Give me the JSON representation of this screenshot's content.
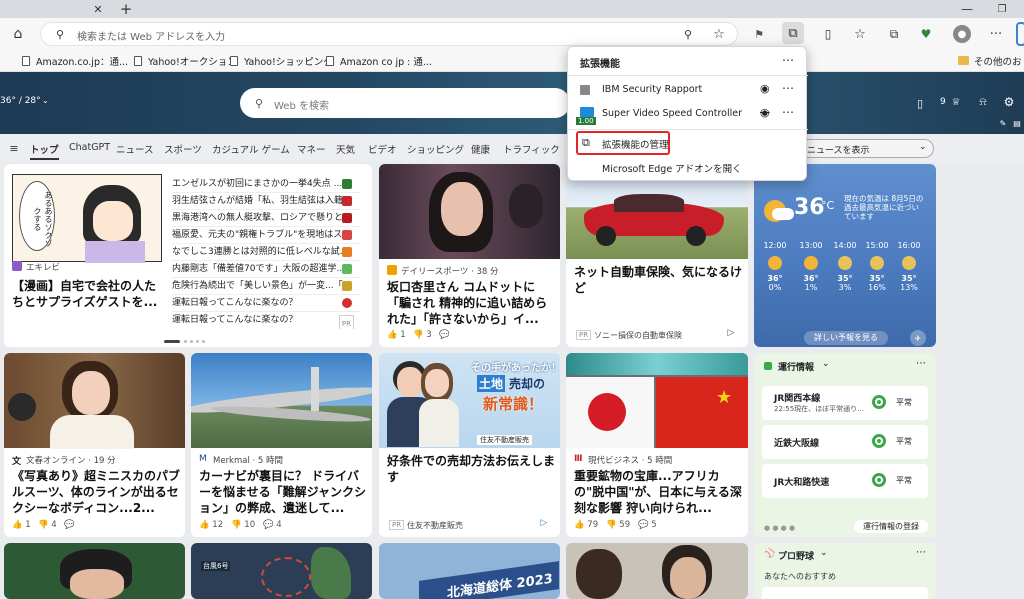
{
  "browser": {
    "address_placeholder": "検索または Web アドレスを入力",
    "bookmarks": [
      "Amazon.co.jp：通...",
      "Yahoo!オークション",
      "Yahoo!ショッピング",
      "Amazon co jp : 通...",
      "その他のお"
    ]
  },
  "hero": {
    "temp": "36° / 28°",
    "search_placeholder": "Web を検索",
    "points": "9"
  },
  "nav": {
    "items": [
      "トップ",
      "ChatGPT",
      "ニュース",
      "スポーツ",
      "カジュアル ゲーム",
      "マネー",
      "天気",
      "ビデオ",
      "ショッピング",
      "健康",
      "トラフィック"
    ],
    "show_news_label": "ニュースを表示"
  },
  "extensions_menu": {
    "title": "拡張機能",
    "items": [
      "IBM Security Rapport",
      "Super Video Speed Controller"
    ],
    "speed_badge": "1.00",
    "manage_label": "拡張機能の管理",
    "addons_label": "Microsoft Edge アドオンを開く"
  },
  "card1": {
    "source": "エキレビ",
    "title": "【漫画】自宅で会社の人たちとサプライズゲストを...",
    "comic_text": "あるあるゾクゾクする",
    "headlines": [
      "エンゼルスが初回にまさかの一挙4失点 ...",
      "羽生結弦さんが結婚「私、羽生結弦は入籍...",
      "黒海港湾への無人艇攻撃、ロシアで懸りと...",
      "福原愛、元夫の\"親権トラブル\"を現地はス...",
      "なでしこ3連勝とは対照的に低レベルな試...",
      "内藤剛志「備差値70です」大阪の超進学...",
      "危険行為続出で「美しい景色」が一変...「...",
      "運転日報ってこんなに楽なの？"
    ],
    "pr": "PR"
  },
  "card2": {
    "source": "デイリースポーツ · 38 分",
    "title": "坂口杏里さん コムドットに「騙され 精神的に追い詰められた」「許さないから」イ...",
    "likes": "1",
    "comments": "3"
  },
  "card3": {
    "title": "ネット自動車保険、気になるけど",
    "source": "ソニー損保の自動車保険",
    "pr": "PR"
  },
  "weather": {
    "temp": "36",
    "unit": "°C",
    "note": "現在の気温は 8月5日の過去最高気温に近づいています",
    "hours": [
      "12:00",
      "13:00",
      "14:00",
      "15:00",
      "16:00"
    ],
    "temps": [
      "36°",
      "36°",
      "35°",
      "35°",
      "35°"
    ],
    "rain": [
      "0%",
      "1%",
      "3%",
      "16%",
      "13%"
    ],
    "detail_label": "詳しい予報を見る"
  },
  "card4": {
    "source": "文春オンライン · 19 分",
    "title": "《写真あり》超ミニスカのパブルスーツ、体のラインが出るセクシーなボディコン...2...",
    "likes": "1",
    "comments": "4"
  },
  "card5": {
    "source": "Merkmal · 5 時間",
    "title": "カーナビが裏目に？ ドライバーを悩ませる「難解ジャンクション」の弊成、遺迷して...",
    "likes": "12",
    "dislikes": "10",
    "comments": "4"
  },
  "card6": {
    "ad_text1": "その手があったか！",
    "ad_text2": "土地",
    "ad_text3": "売却の",
    "ad_text4": "新常識！",
    "ad_brand": "住友不動産販売",
    "title": "好条件での売却方法お伝えします",
    "source": "住友不動産販売",
    "pr": "PR"
  },
  "card7": {
    "source": "現代ビジネス · 5 時間",
    "title": "重要鉱物の宝庫...アフリカの\"脱中国\"が、日本に与える深刻な影響 狩い向けられ...",
    "likes": "79",
    "dislikes": "59",
    "comments": "5"
  },
  "traffic": {
    "title": "運行情報",
    "lines": [
      {
        "name": "JR関西本線",
        "sub": "22:55現在、ほぼ平常通り…",
        "status": "平常"
      },
      {
        "name": "近鉄大阪線",
        "sub": "",
        "status": "平常"
      },
      {
        "name": "JR大和路快速",
        "sub": "",
        "status": "平常"
      }
    ],
    "register_label": "運行情報の登録"
  },
  "row3": {
    "banner_text": "北海道総体 2023",
    "typhoon_label": "台風6号",
    "baseball_title": "プロ野球",
    "baseball_sub": "あなたへのおすすめ"
  }
}
